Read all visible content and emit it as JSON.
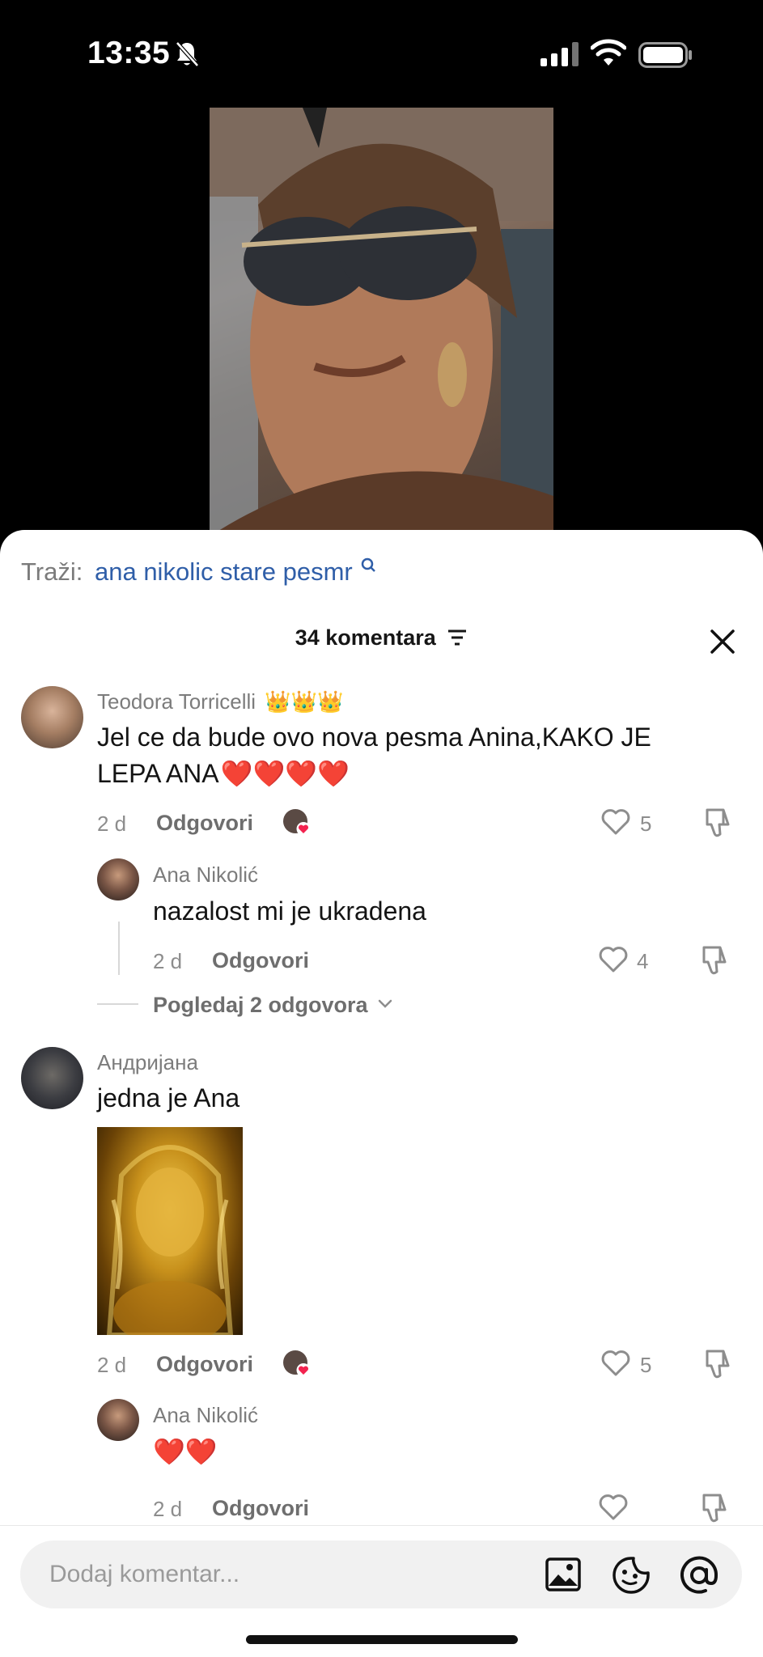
{
  "status_bar": {
    "time": "13:35"
  },
  "search": {
    "label": "Traži:",
    "query": "ana nikolic stare pesmr"
  },
  "header": {
    "title": "34 komentara"
  },
  "comments": [
    {
      "username": "Teodora Torricelli",
      "badge": "👑👑👑",
      "text_line1": "Jel ce da bude ovo nova pesma Anina,KAKO JE",
      "text_line2": "LEPA ANA",
      "hearts": "❤️❤️❤️❤️",
      "age": "2 d",
      "reply_label": "Odgovori",
      "likes": "5"
    },
    {
      "username": "Ana Nikolić",
      "text": "nazalost mi je ukradena",
      "age": "2 d",
      "reply_label": "Odgovori",
      "likes": "4"
    },
    {
      "username": "Андријана",
      "text": "jedna je Ana",
      "age": "2 d",
      "reply_label": "Odgovori",
      "likes": "5"
    },
    {
      "username": "Ana Nikolić",
      "text": "❤️❤️",
      "age": "2 d",
      "reply_label": "Odgovori"
    }
  ],
  "view_replies": "Pogledaj 2 odgovora",
  "composer": {
    "placeholder": "Dodaj komentar..."
  },
  "icons": {
    "status": [
      "bell-slash-icon",
      "signal-icon",
      "wifi-icon",
      "battery-icon"
    ],
    "header": [
      "filter-icon",
      "close-icon"
    ],
    "composer": [
      "image-icon",
      "sticker-icon",
      "at-icon"
    ]
  },
  "colors": {
    "search_query": "#2f5ea8",
    "sheet_bg": "#ffffff",
    "heart_badge": "#f3234f"
  }
}
